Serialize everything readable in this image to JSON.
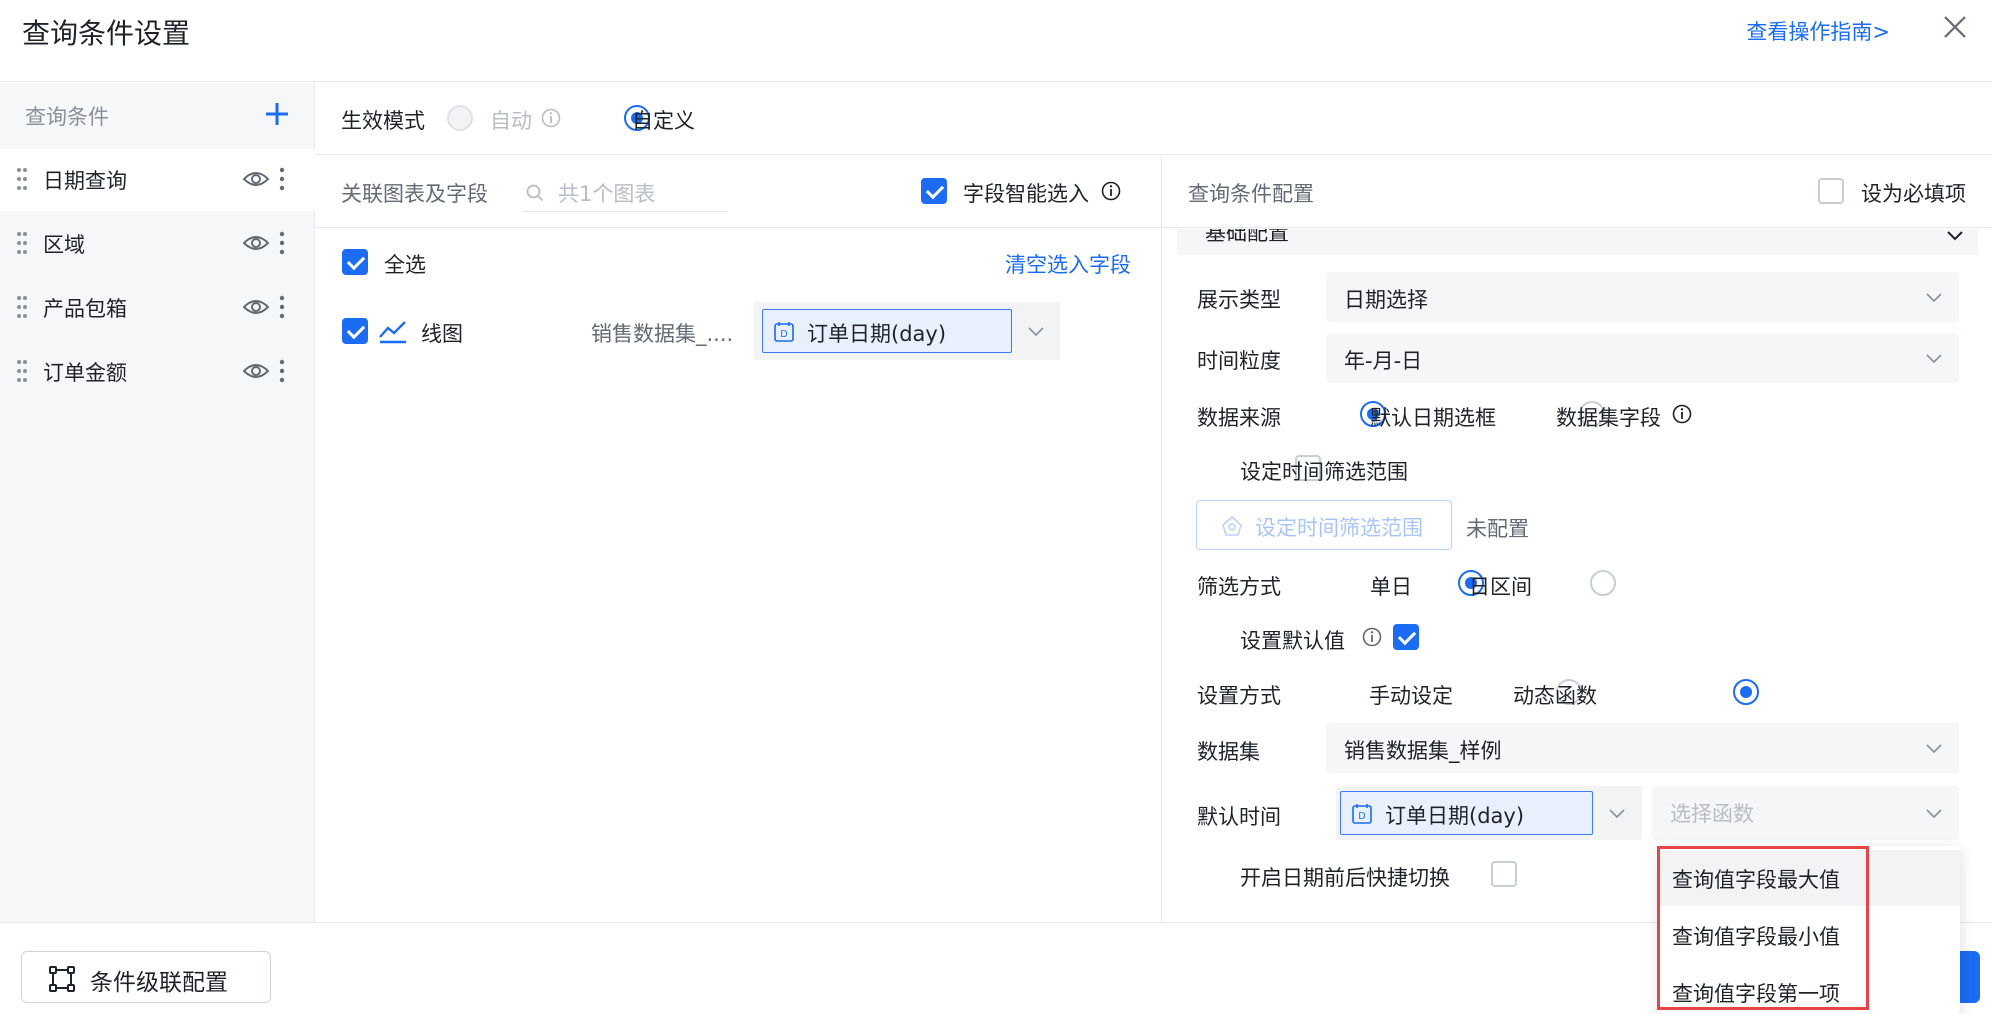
{
  "header": {
    "title": "查询条件设置",
    "guide_link": "查看操作指南>"
  },
  "sidebar": {
    "heading": "查询条件",
    "items": [
      {
        "label": "日期查询"
      },
      {
        "label": "区域"
      },
      {
        "label": "产品包箱"
      },
      {
        "label": "订单金额"
      }
    ]
  },
  "mode": {
    "label": "生效模式",
    "option_auto": "自动",
    "option_custom": "自定义",
    "selected": "自定义"
  },
  "link_panel": {
    "label": "关联图表及字段",
    "search_placeholder": "共1个图表",
    "smart_select_label": "字段智能选入",
    "select_all_label": "全选",
    "clear_link": "清空选入字段",
    "rows": [
      {
        "chart_name": "线图",
        "dataset": "销售数据集_....",
        "field": "订单日期(day)"
      }
    ]
  },
  "config": {
    "title": "查询条件配置",
    "required_label": "设为必填项",
    "section_title": "基础配置",
    "display_type_label": "展示类型",
    "display_type_value": "日期选择",
    "granularity_label": "时间粒度",
    "granularity_value": "年-月-日",
    "source_label": "数据来源",
    "source_option_default": "默认日期选框",
    "source_option_dataset": "数据集字段",
    "time_range_checkbox": "设定时间筛选范围",
    "time_range_button": "设定时间筛选范围",
    "time_range_status": "未配置",
    "filter_mode_label": "筛选方式",
    "filter_single": "单日",
    "filter_range": "日区间",
    "default_value_label": "设置默认值",
    "set_mode_label": "设置方式",
    "set_mode_manual": "手动设定",
    "set_mode_dynamic": "动态函数",
    "dataset_label": "数据集",
    "dataset_value": "销售数据集_样例",
    "default_time_label": "默认时间",
    "default_time_field": "订单日期(day)",
    "function_placeholder": "选择函数",
    "quick_switch_label": "开启日期前后快捷切换"
  },
  "dropdown": {
    "options": [
      "查询值字段最大值",
      "查询值字段最小值",
      "查询值字段第一项"
    ]
  },
  "footer": {
    "cascade_button": "条件级联配置"
  },
  "colors": {
    "accent": "#1b6cf2",
    "highlight_box": "#e54545"
  }
}
